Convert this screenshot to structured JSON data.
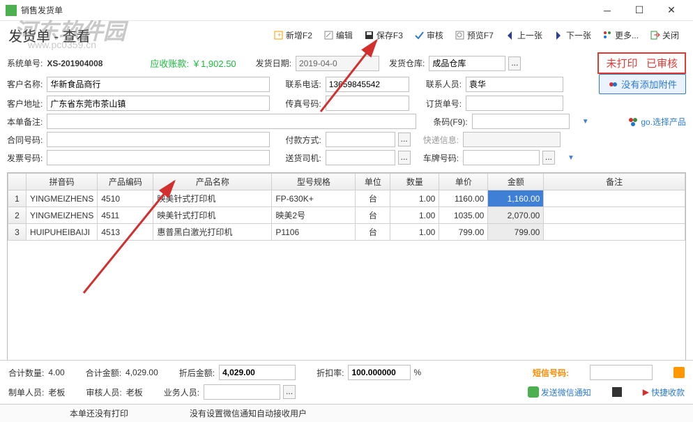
{
  "window": {
    "title": "销售发货单"
  },
  "watermark": {
    "main": "河东软件园",
    "url": "www.pc0359.cn"
  },
  "page": {
    "title": "发货单 - 查看"
  },
  "toolbar": {
    "new": "新增F2",
    "edit": "编辑",
    "save": "保存F3",
    "audit": "审核",
    "preview": "预览F7",
    "prev": "上一张",
    "next": "下一张",
    "more": "更多...",
    "close": "关闭"
  },
  "status": {
    "unprinted": "未打印",
    "audited": "已审核"
  },
  "actions": {
    "no_attachment": "没有添加附件",
    "select_product": "go.选择产品"
  },
  "form": {
    "sys_no_label": "系统单号:",
    "sys_no": "XS-201904008",
    "receivable_label": "应收账款:",
    "receivable": "￥1,902.50",
    "ship_date_label": "发货日期:",
    "ship_date": "2019-04-0",
    "warehouse_label": "发货仓库:",
    "warehouse": "成品仓库",
    "customer_label": "客户名称:",
    "customer": "华新食品商行",
    "phone_label": "联系电话:",
    "phone": "13659845542",
    "contact_label": "联系人员:",
    "contact": "袁华",
    "address_label": "客户地址:",
    "address": "广东省东莞市茶山镇",
    "fax_label": "传真号码:",
    "fax": "",
    "order_no_label": "订货单号:",
    "order_no": "",
    "memo_label": "本单备注:",
    "memo": "",
    "barcode_label": "条码(F9):",
    "barcode": "",
    "contract_label": "合同号码:",
    "contract": "",
    "pay_method_label": "付款方式:",
    "pay_method": "",
    "express_label": "快递信息:",
    "express": "",
    "invoice_label": "发票号码:",
    "invoice": "",
    "driver_label": "送货司机:",
    "driver": "",
    "plate_label": "车牌号码:",
    "plate": ""
  },
  "grid": {
    "headers": {
      "pinyin": "拼音码",
      "code": "产品编码",
      "name": "产品名称",
      "spec": "型号规格",
      "unit": "单位",
      "qty": "数量",
      "price": "单价",
      "amount": "金额",
      "remark": "备注"
    },
    "rows": [
      {
        "n": "1",
        "pinyin": "YINGMEIZHENS",
        "code": "4510",
        "name": "映美针式打印机",
        "spec": "FP-630K+",
        "unit": "台",
        "qty": "1.00",
        "price": "1160.00",
        "amount": "1,160.00",
        "highlight": true
      },
      {
        "n": "2",
        "pinyin": "YINGMEIZHENS",
        "code": "4511",
        "name": "映美针式打印机",
        "spec": "映美2号",
        "unit": "台",
        "qty": "1.00",
        "price": "1035.00",
        "amount": "2,070.00",
        "highlight": false
      },
      {
        "n": "3",
        "pinyin": "HUIPUHEIBAIJI",
        "code": "4513",
        "name": "惠普黑白激光打印机",
        "spec": "P1106",
        "unit": "台",
        "qty": "1.00",
        "price": "799.00",
        "amount": "799.00",
        "highlight": false
      }
    ]
  },
  "totals": {
    "qty_label": "合计数量:",
    "qty": "4.00",
    "amount_label": "合计金额:",
    "amount": "4,029.00",
    "after_discount_label": "折后金额:",
    "after_discount": "4,029.00",
    "discount_label": "折扣率:",
    "discount": "100.000000",
    "discount_suffix": "%",
    "sms_label": "短信号码:",
    "maker_label": "制单人员:",
    "maker": "老板",
    "auditor_label": "审核人员:",
    "auditor": "老板",
    "biz_person_label": "业务人员:",
    "biz_person": "",
    "wechat_label": "发送微信通知",
    "quick_collect": "快捷收款"
  },
  "statusbar": {
    "left": "本单还没有打印",
    "right": "没有设置微信通知自动接收用户"
  }
}
